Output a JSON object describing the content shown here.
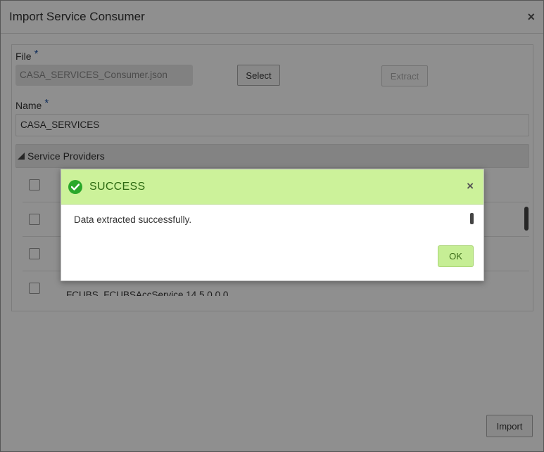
{
  "dialog": {
    "title": "Import Service Consumer",
    "close_symbol": "×",
    "file_label": "File",
    "required_mark": "*",
    "file_value": "CASA_SERVICES_Consumer.json",
    "select_label": "Select",
    "extract_label": "Extract",
    "name_label": "Name",
    "name_value": "CASA_SERVICES",
    "section_label": "Service Providers",
    "rows": [
      {
        "label": ""
      },
      {
        "label": ""
      },
      {
        "label": ""
      },
      {
        "label": "FCUBS_FCUBSAccService 14.5.0.0.0"
      }
    ],
    "import_label": "Import"
  },
  "modal": {
    "title": "SUCCESS",
    "close_symbol": "×",
    "message": "Data extracted successfully.",
    "ok_label": "OK",
    "icon": "check-circle-icon",
    "accent_color": "#ccf29a"
  }
}
